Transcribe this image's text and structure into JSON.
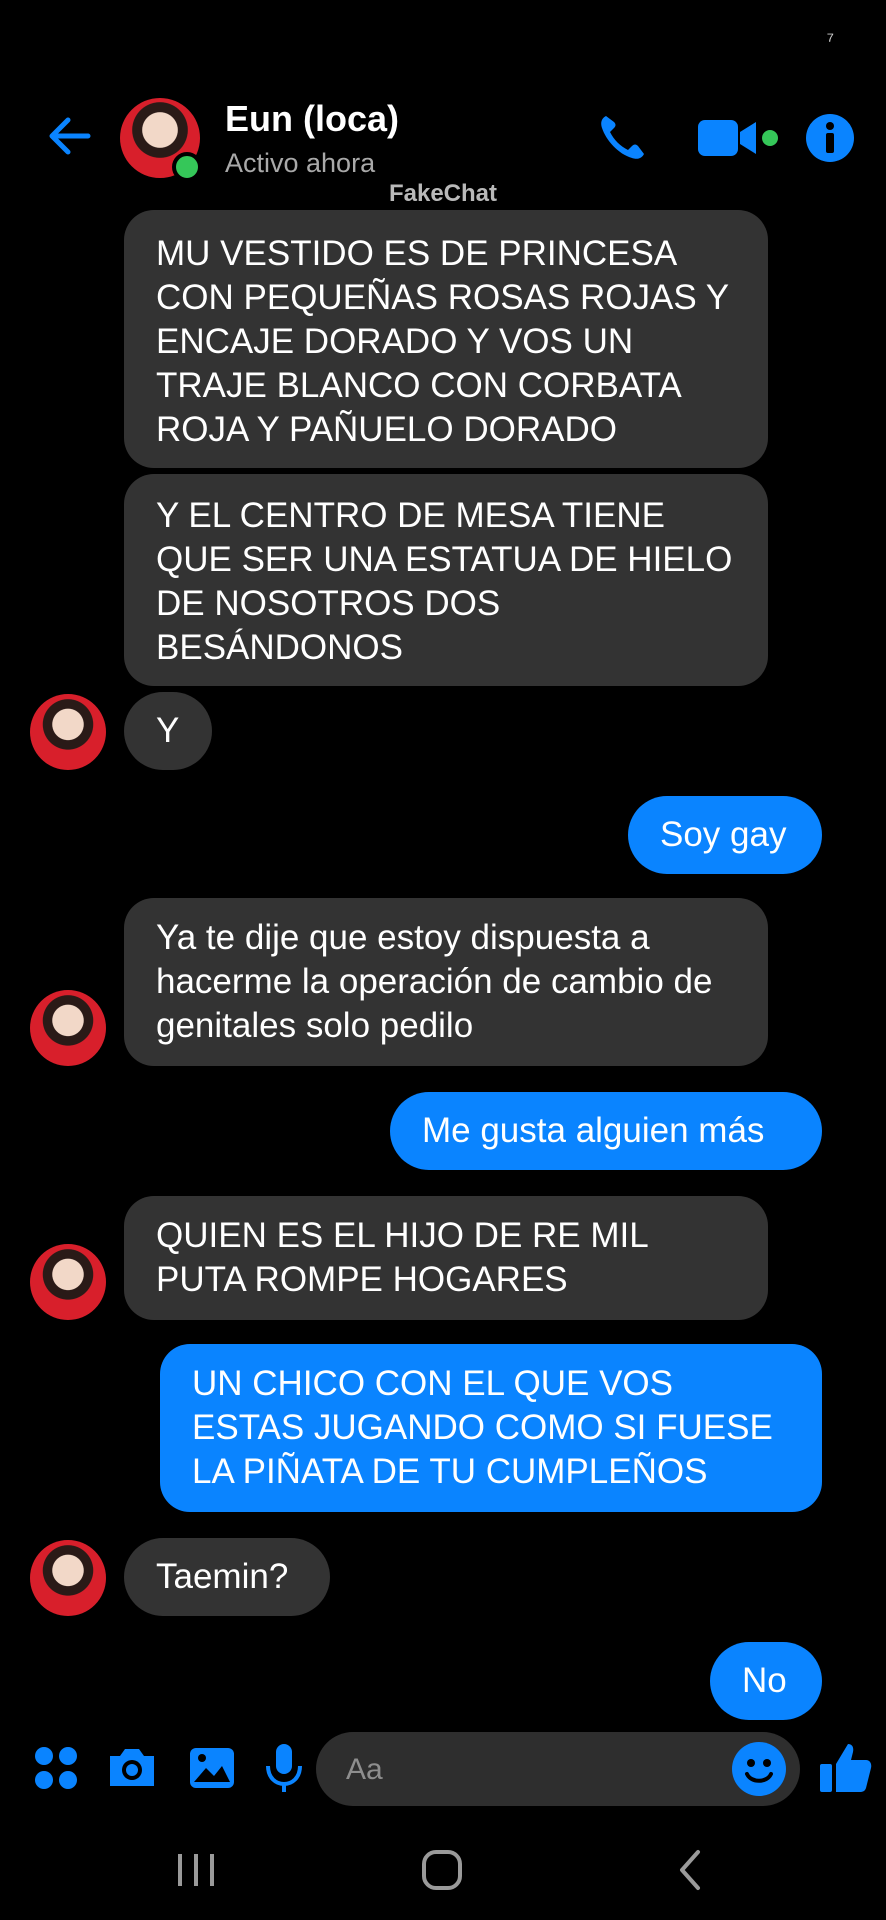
{
  "status_bar": {
    "glyph": "⁷"
  },
  "header": {
    "contact_name": "Eun (loca)",
    "contact_status": "Activo ahora",
    "watermark": "FakeChat",
    "icons": [
      "back-arrow-icon",
      "phone-icon",
      "video-camera-icon",
      "info-icon"
    ]
  },
  "messages": [
    {
      "side": "received",
      "text": "MU VESTIDO ES DE PRINCESA CON PEQUEÑAS ROSAS ROJAS Y ENCAJE DORADO Y VOS UN TRAJE BLANCO CON CORBATA ROJA Y PAÑUELO DORADO"
    },
    {
      "side": "received",
      "text": "Y EL CENTRO DE MESA TIENE QUE SER UNA ESTATUA DE HIELO DE NOSOTROS DOS BESÁNDONOS"
    },
    {
      "side": "received",
      "text": "Y"
    },
    {
      "side": "sent",
      "text": "Soy gay"
    },
    {
      "side": "received",
      "text": "Ya te dije que estoy dispuesta a hacerme la operación de cambio de genitales solo pedilo"
    },
    {
      "side": "sent",
      "text": "Me gusta alguien más"
    },
    {
      "side": "received",
      "text": "QUIEN ES EL HIJO DE RE MIL PUTA ROMPE HOGARES"
    },
    {
      "side": "sent",
      "text": "UN CHICO CON EL QUE VOS ESTAS JUGANDO COMO SI FUESE LA PIÑATA DE TU CUMPLEÑOS"
    },
    {
      "side": "received",
      "text": "Taemin?"
    },
    {
      "side": "sent",
      "text": "No"
    }
  ],
  "composer": {
    "placeholder": "Aa",
    "icons": [
      "apps-icon",
      "camera-icon",
      "gallery-icon",
      "microphone-icon",
      "emoji-icon",
      "thumbs-up-icon"
    ]
  },
  "nav_bar": {
    "icons": [
      "recent-apps-icon",
      "home-icon",
      "back-icon"
    ]
  },
  "colors": {
    "accent": "#0a84ff",
    "received_bubble": "#333333",
    "background": "#000000",
    "online": "#35c759"
  }
}
